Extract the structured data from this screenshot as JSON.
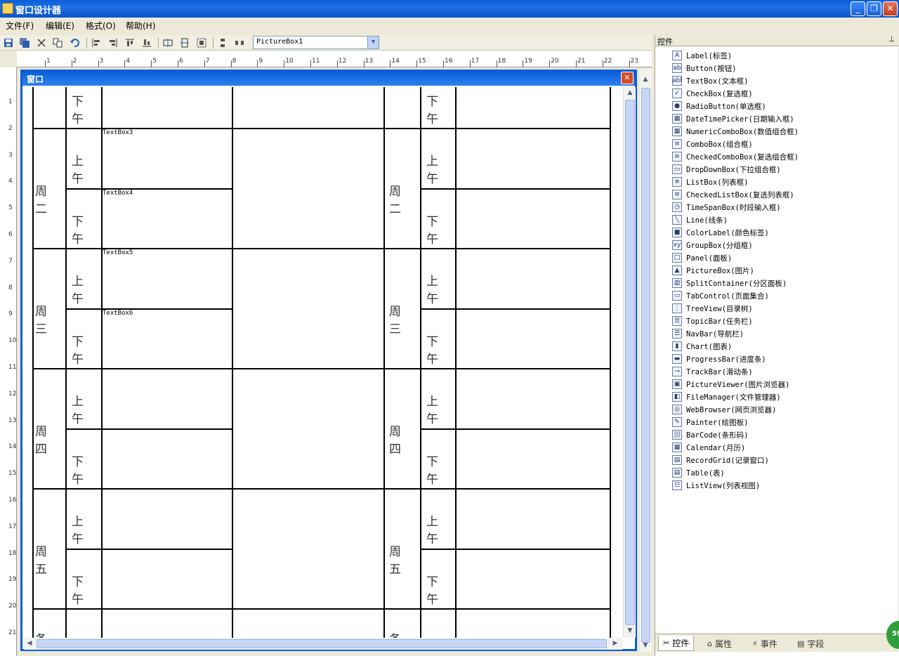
{
  "app": {
    "title": "窗口设计器"
  },
  "window_buttons": {
    "minimize": "_",
    "restore": "❐",
    "close": "✕"
  },
  "menu": [
    {
      "label": "文件(F)"
    },
    {
      "label": "编辑(E)"
    },
    {
      "label": "格式(O)"
    },
    {
      "label": "帮助(H)"
    }
  ],
  "toolbar": {
    "selected_control": "PictureBox1"
  },
  "ruler": {
    "h": [
      "1",
      "2",
      "3",
      "4",
      "5",
      "6",
      "7",
      "8",
      "9",
      "10",
      "11",
      "12",
      "13",
      "14",
      "15",
      "16",
      "17",
      "18",
      "19",
      "20",
      "21",
      "22",
      "23"
    ],
    "v": [
      "1",
      "2",
      "3",
      "4",
      "5",
      "6",
      "7",
      "8",
      "9",
      "10",
      "11",
      "12",
      "13",
      "14",
      "15",
      "16",
      "17",
      "18",
      "19",
      "20",
      "21"
    ]
  },
  "form": {
    "title": "窗口",
    "close": "✕"
  },
  "schedule": {
    "am": "上午",
    "pm": "下午",
    "days": [
      "周二",
      "周三",
      "周四",
      "周五"
    ],
    "remark": "备注",
    "textboxes": [
      "TextBox3",
      "TextBox4",
      "TextBox5",
      "TextBox6"
    ]
  },
  "panel": {
    "title": "控件",
    "pin": "⊥",
    "controls": [
      {
        "label": "Label(标签)",
        "icon": "A"
      },
      {
        "label": "Button(按钮)",
        "icon": "ab"
      },
      {
        "label": "TextBox(文本框)",
        "icon": "abl"
      },
      {
        "label": "CheckBox(复选框)",
        "icon": "✓"
      },
      {
        "label": "RadioButton(单选框)",
        "icon": "●"
      },
      {
        "label": "DateTimePicker(日期输入框)",
        "icon": "▦"
      },
      {
        "label": "NumericComboBox(数值组合框)",
        "icon": "▦"
      },
      {
        "label": "ComboBox(组合框)",
        "icon": "≡"
      },
      {
        "label": "CheckedComboBox(复选组合框)",
        "icon": "≡"
      },
      {
        "label": "DropDownBox(下拉组合框)",
        "icon": "▭"
      },
      {
        "label": "ListBox(列表框)",
        "icon": "≡"
      },
      {
        "label": "CheckedListBox(复选列表框)",
        "icon": "≡"
      },
      {
        "label": "TimeSpanBox(时段输入框)",
        "icon": "◷"
      },
      {
        "label": "Line(线条)",
        "icon": "╲"
      },
      {
        "label": "ColorLabel(颜色标签)",
        "icon": "■"
      },
      {
        "label": "GroupBox(分组框)",
        "icon": "xy"
      },
      {
        "label": "Panel(面板)",
        "icon": "□"
      },
      {
        "label": "PictureBox(图片)",
        "icon": "▲"
      },
      {
        "label": "SplitContainer(分区面板)",
        "icon": "▥"
      },
      {
        "label": "TabControl(页面集合)",
        "icon": "▭"
      },
      {
        "label": "TreeView(目录树)",
        "icon": "⋮"
      },
      {
        "label": "TopicBar(任务栏)",
        "icon": "☰"
      },
      {
        "label": "NavBar(导航栏)",
        "icon": "☰"
      },
      {
        "label": "Chart(图表)",
        "icon": "▮"
      },
      {
        "label": "ProgressBar(进度条)",
        "icon": "▬"
      },
      {
        "label": "TrackBar(滑动条)",
        "icon": "⊸"
      },
      {
        "label": "PictureViewer(图片浏览器)",
        "icon": "▣"
      },
      {
        "label": "FileManager(文件管理器)",
        "icon": "◧"
      },
      {
        "label": "WebBrowser(网页浏览器)",
        "icon": "◎"
      },
      {
        "label": "Painter(绘图板)",
        "icon": "✎"
      },
      {
        "label": "BarCode(条形码)",
        "icon": "|||"
      },
      {
        "label": "Calendar(月历)",
        "icon": "▦"
      },
      {
        "label": "RecordGrid(记录窗口)",
        "icon": "▤"
      },
      {
        "label": "Table(表)",
        "icon": "▤"
      },
      {
        "label": "ListView(列表视图)",
        "icon": "☷"
      }
    ],
    "tabs": [
      {
        "label": "控件",
        "icon": "✂"
      },
      {
        "label": "属性",
        "icon": "⌂"
      },
      {
        "label": "事件",
        "icon": "⚡"
      },
      {
        "label": "字段",
        "icon": "▤"
      }
    ]
  },
  "badge": "59"
}
